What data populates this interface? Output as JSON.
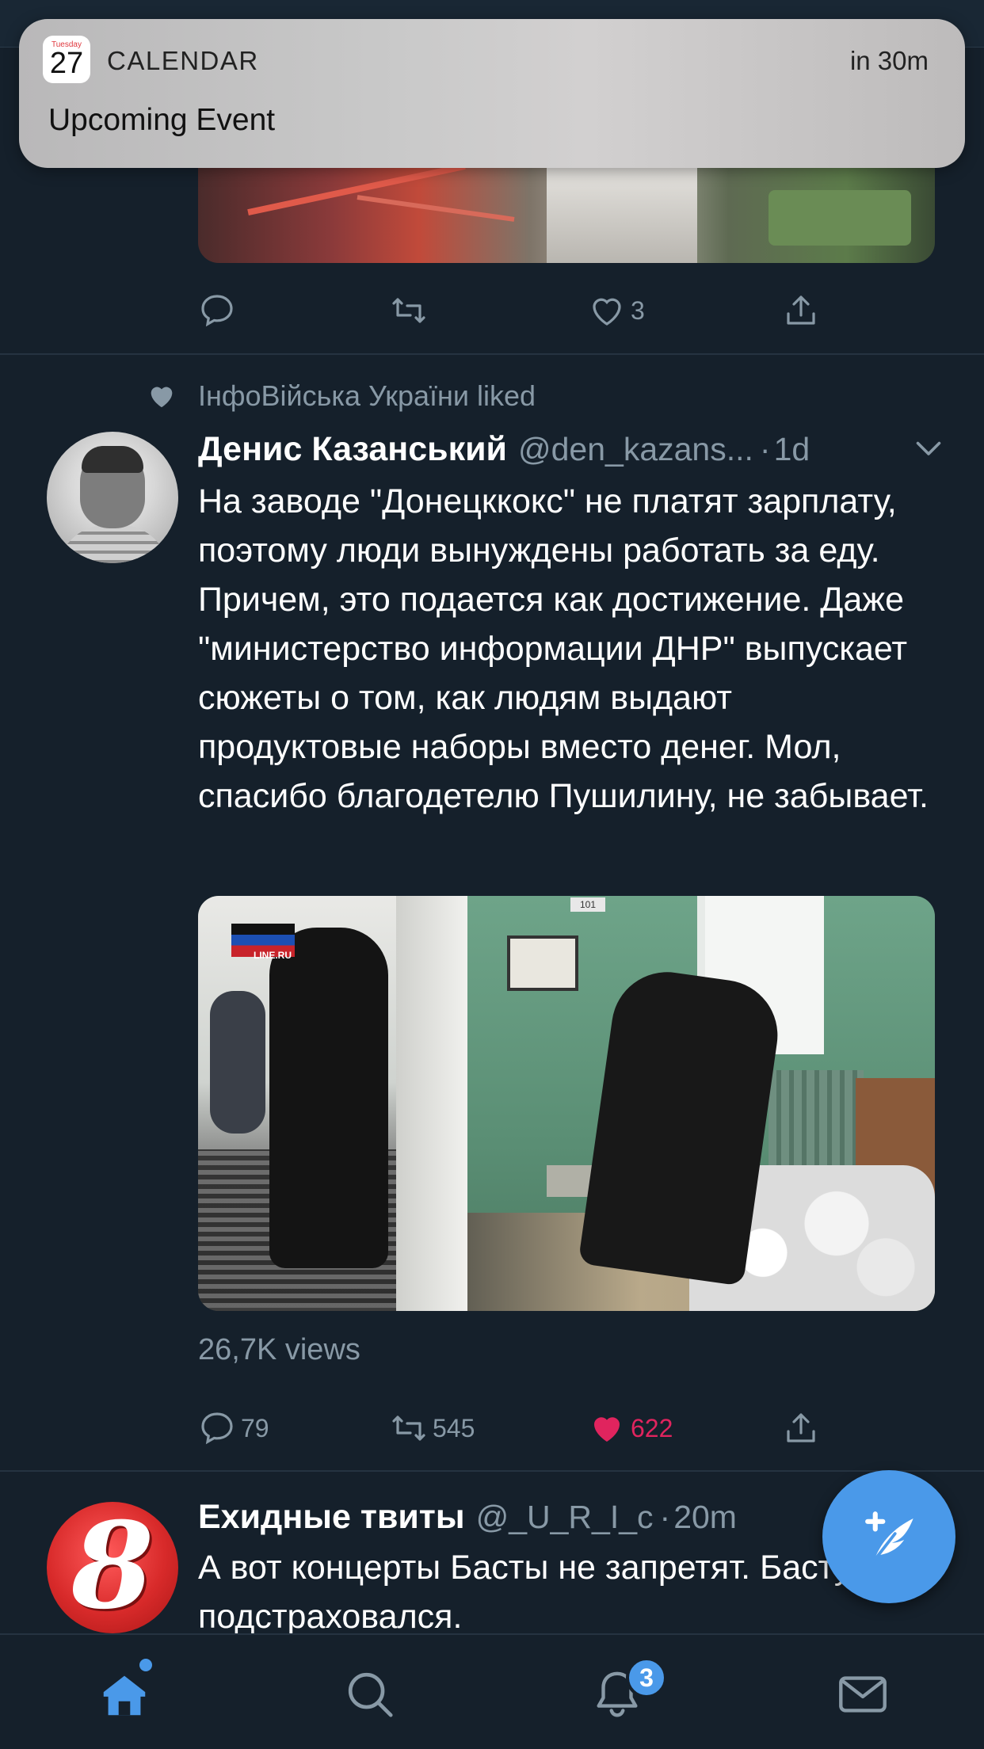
{
  "notification": {
    "calendar_icon_day_of_week": "Tuesday",
    "calendar_icon_day": "27",
    "app_name": "CALENDAR",
    "time": "in 30m",
    "title": "Upcoming Event"
  },
  "tweet1": {
    "actions": {
      "replies": "",
      "retweets": "",
      "likes": "3"
    }
  },
  "tweet2": {
    "liked_by": "ІнфоВійська України liked",
    "author_name": "Денис Казанський",
    "author_handle": "@den_kazans...",
    "separator": "·",
    "time": "1d",
    "text": "На заводе \"Донецккокс\" не платят зарплату, поэтому люди вынуждены работать за еду. Причем, это подается как достижение. Даже \"министерство информации ДНР\" выпускает сюжеты о том, как людям выдают продуктовые наборы вместо денег. Мол, спасибо благодетелю Пушилину, не забывает.",
    "media_sign": "101",
    "media_watermark": "LINE.RU",
    "views": "26,7K views",
    "actions": {
      "replies": "79",
      "retweets": "545",
      "likes": "622",
      "liked": true
    }
  },
  "tweet3": {
    "author_name": "Ехидные твиты",
    "author_handle": "@_U_R_I_c",
    "separator": "·",
    "time": "20m",
    "avatar_text": "8",
    "text_line1": "А вот концерты Басты не запретят. Басту",
    "text_line2": "подстраховался."
  },
  "tabbar": {
    "notifications_badge": "3",
    "active_tab": "home"
  },
  "colors": {
    "background": "#15202b",
    "accent": "#4a99e9",
    "like": "#e0245e",
    "secondary_text": "#8899a6"
  },
  "icons": [
    "heart-icon",
    "reply-icon",
    "retweet-icon",
    "share-icon",
    "chevron-down-icon",
    "compose-icon",
    "home-icon",
    "search-icon",
    "bell-icon",
    "mail-icon"
  ]
}
